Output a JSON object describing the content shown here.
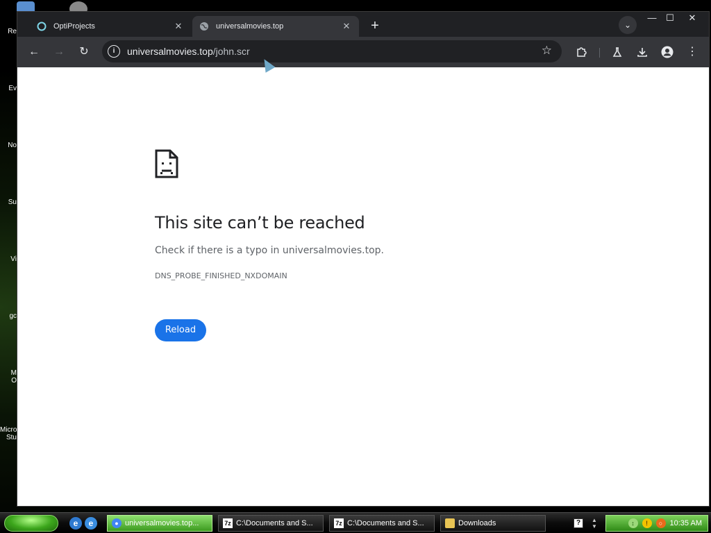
{
  "desktop": {
    "icon_labels": [
      "Re",
      "Ev",
      "No",
      "Su",
      "Vi",
      "gc",
      "M\nO",
      "Micro\nStu"
    ]
  },
  "browser": {
    "tabs": [
      {
        "title": "OptiProjects",
        "favicon": "opti-logo-icon",
        "active": false
      },
      {
        "title": "universalmovies.top",
        "favicon": "globe-icon",
        "active": true
      }
    ],
    "new_tab_symbol": "+",
    "tab_search_symbol": "⌄",
    "window_controls": {
      "minimize": "—",
      "maximize": "☐",
      "close": "✕"
    },
    "toolbar": {
      "back": "←",
      "forward": "→",
      "reload": "↻",
      "info_symbol": "i",
      "url_host": "universalmovies.top",
      "url_path": "/john.scr",
      "bookmark_star": "☆",
      "extensions_icon": "puzzle-icon",
      "labs_icon": "flask-icon",
      "download_icon": "download-icon",
      "profile_icon": "profile-icon",
      "menu_symbol": "⋮"
    }
  },
  "error_page": {
    "title": "This site can’t be reached",
    "description": "Check if there is a typo in universalmovies.top.",
    "error_code": "DNS_PROBE_FINISHED_NXDOMAIN",
    "reload_label": "Reload",
    "icon": "sad-document-icon"
  },
  "taskbar": {
    "tasks": [
      {
        "label": "universalmovies.top...",
        "icon": "chrome-icon",
        "active": true
      },
      {
        "label": "C:\\Documents and S...",
        "icon": "7z-icon",
        "active": false
      },
      {
        "label": "C:\\Documents and S...",
        "icon": "7z-icon",
        "active": false
      },
      {
        "label": "Downloads",
        "icon": "folder-icon",
        "active": false
      }
    ],
    "clock": "10:35 AM",
    "help_symbol": "?"
  },
  "colors": {
    "reload_button": "#1a73e8",
    "title_text": "#202124",
    "secondary_text": "#5f6368",
    "chrome_dark": "#202124",
    "chrome_toolbar": "#35363a"
  }
}
